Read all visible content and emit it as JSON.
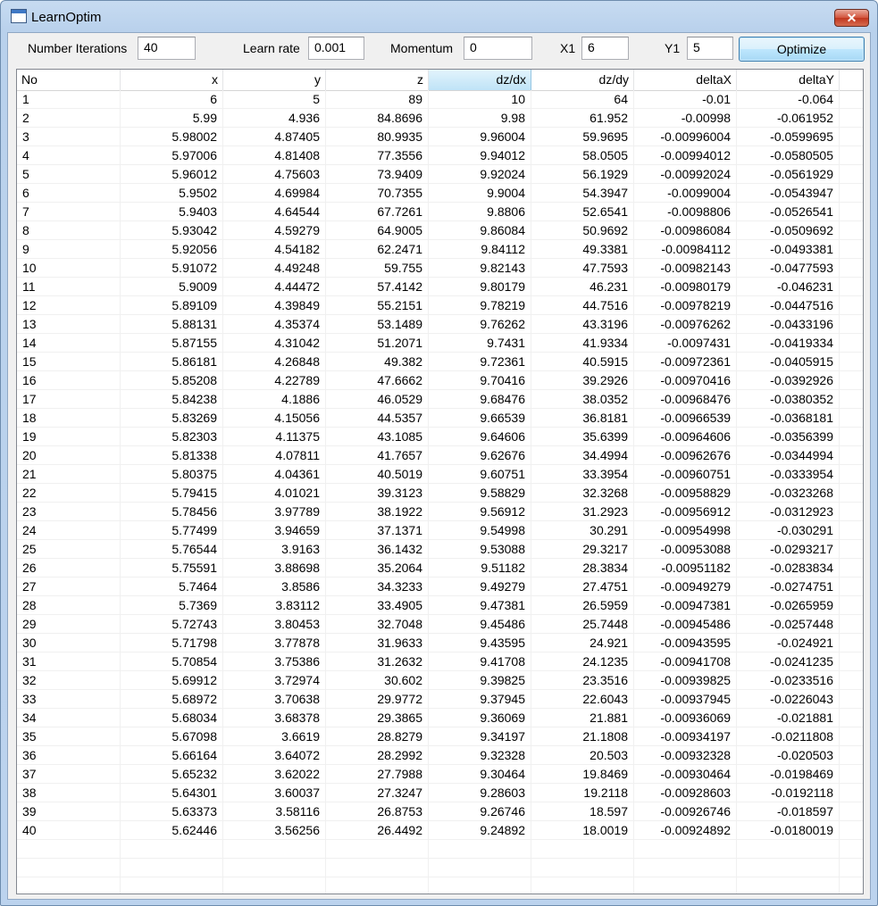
{
  "window": {
    "title": "LearnOptim",
    "close_label": "✕"
  },
  "toolbar": {
    "iterations_label": "Number Iterations",
    "iterations_value": "40",
    "learn_rate_label": "Learn rate",
    "learn_rate_value": "0.001",
    "momentum_label": "Momentum",
    "momentum_value": "0",
    "x1_label": "X1",
    "x1_value": "6",
    "y1_label": "Y1",
    "y1_value": "5",
    "optimize_label": "Optimize"
  },
  "table": {
    "selected_column": 4,
    "columns": [
      "No",
      "x",
      "y",
      "z",
      "dz/dx",
      "dz/dy",
      "deltaX",
      "deltaY"
    ],
    "rows": [
      [
        "1",
        "6",
        "5",
        "89",
        "10",
        "64",
        "-0.01",
        "-0.064"
      ],
      [
        "2",
        "5.99",
        "4.936",
        "84.8696",
        "9.98",
        "61.952",
        "-0.00998",
        "-0.061952"
      ],
      [
        "3",
        "5.98002",
        "4.87405",
        "80.9935",
        "9.96004",
        "59.9695",
        "-0.00996004",
        "-0.0599695"
      ],
      [
        "4",
        "5.97006",
        "4.81408",
        "77.3556",
        "9.94012",
        "58.0505",
        "-0.00994012",
        "-0.0580505"
      ],
      [
        "5",
        "5.96012",
        "4.75603",
        "73.9409",
        "9.92024",
        "56.1929",
        "-0.00992024",
        "-0.0561929"
      ],
      [
        "6",
        "5.9502",
        "4.69984",
        "70.7355",
        "9.9004",
        "54.3947",
        "-0.0099004",
        "-0.0543947"
      ],
      [
        "7",
        "5.9403",
        "4.64544",
        "67.7261",
        "9.8806",
        "52.6541",
        "-0.0098806",
        "-0.0526541"
      ],
      [
        "8",
        "5.93042",
        "4.59279",
        "64.9005",
        "9.86084",
        "50.9692",
        "-0.00986084",
        "-0.0509692"
      ],
      [
        "9",
        "5.92056",
        "4.54182",
        "62.2471",
        "9.84112",
        "49.3381",
        "-0.00984112",
        "-0.0493381"
      ],
      [
        "10",
        "5.91072",
        "4.49248",
        "59.755",
        "9.82143",
        "47.7593",
        "-0.00982143",
        "-0.0477593"
      ],
      [
        "11",
        "5.9009",
        "4.44472",
        "57.4142",
        "9.80179",
        "46.231",
        "-0.00980179",
        "-0.046231"
      ],
      [
        "12",
        "5.89109",
        "4.39849",
        "55.2151",
        "9.78219",
        "44.7516",
        "-0.00978219",
        "-0.0447516"
      ],
      [
        "13",
        "5.88131",
        "4.35374",
        "53.1489",
        "9.76262",
        "43.3196",
        "-0.00976262",
        "-0.0433196"
      ],
      [
        "14",
        "5.87155",
        "4.31042",
        "51.2071",
        "9.7431",
        "41.9334",
        "-0.0097431",
        "-0.0419334"
      ],
      [
        "15",
        "5.86181",
        "4.26848",
        "49.382",
        "9.72361",
        "40.5915",
        "-0.00972361",
        "-0.0405915"
      ],
      [
        "16",
        "5.85208",
        "4.22789",
        "47.6662",
        "9.70416",
        "39.2926",
        "-0.00970416",
        "-0.0392926"
      ],
      [
        "17",
        "5.84238",
        "4.1886",
        "46.0529",
        "9.68476",
        "38.0352",
        "-0.00968476",
        "-0.0380352"
      ],
      [
        "18",
        "5.83269",
        "4.15056",
        "44.5357",
        "9.66539",
        "36.8181",
        "-0.00966539",
        "-0.0368181"
      ],
      [
        "19",
        "5.82303",
        "4.11375",
        "43.1085",
        "9.64606",
        "35.6399",
        "-0.00964606",
        "-0.0356399"
      ],
      [
        "20",
        "5.81338",
        "4.07811",
        "41.7657",
        "9.62676",
        "34.4994",
        "-0.00962676",
        "-0.0344994"
      ],
      [
        "21",
        "5.80375",
        "4.04361",
        "40.5019",
        "9.60751",
        "33.3954",
        "-0.00960751",
        "-0.0333954"
      ],
      [
        "22",
        "5.79415",
        "4.01021",
        "39.3123",
        "9.58829",
        "32.3268",
        "-0.00958829",
        "-0.0323268"
      ],
      [
        "23",
        "5.78456",
        "3.97789",
        "38.1922",
        "9.56912",
        "31.2923",
        "-0.00956912",
        "-0.0312923"
      ],
      [
        "24",
        "5.77499",
        "3.94659",
        "37.1371",
        "9.54998",
        "30.291",
        "-0.00954998",
        "-0.030291"
      ],
      [
        "25",
        "5.76544",
        "3.9163",
        "36.1432",
        "9.53088",
        "29.3217",
        "-0.00953088",
        "-0.0293217"
      ],
      [
        "26",
        "5.75591",
        "3.88698",
        "35.2064",
        "9.51182",
        "28.3834",
        "-0.00951182",
        "-0.0283834"
      ],
      [
        "27",
        "5.7464",
        "3.8586",
        "34.3233",
        "9.49279",
        "27.4751",
        "-0.00949279",
        "-0.0274751"
      ],
      [
        "28",
        "5.7369",
        "3.83112",
        "33.4905",
        "9.47381",
        "26.5959",
        "-0.00947381",
        "-0.0265959"
      ],
      [
        "29",
        "5.72743",
        "3.80453",
        "32.7048",
        "9.45486",
        "25.7448",
        "-0.00945486",
        "-0.0257448"
      ],
      [
        "30",
        "5.71798",
        "3.77878",
        "31.9633",
        "9.43595",
        "24.921",
        "-0.00943595",
        "-0.024921"
      ],
      [
        "31",
        "5.70854",
        "3.75386",
        "31.2632",
        "9.41708",
        "24.1235",
        "-0.00941708",
        "-0.0241235"
      ],
      [
        "32",
        "5.69912",
        "3.72974",
        "30.602",
        "9.39825",
        "23.3516",
        "-0.00939825",
        "-0.0233516"
      ],
      [
        "33",
        "5.68972",
        "3.70638",
        "29.9772",
        "9.37945",
        "22.6043",
        "-0.00937945",
        "-0.0226043"
      ],
      [
        "34",
        "5.68034",
        "3.68378",
        "29.3865",
        "9.36069",
        "21.881",
        "-0.00936069",
        "-0.021881"
      ],
      [
        "35",
        "5.67098",
        "3.6619",
        "28.8279",
        "9.34197",
        "21.1808",
        "-0.00934197",
        "-0.0211808"
      ],
      [
        "36",
        "5.66164",
        "3.64072",
        "28.2992",
        "9.32328",
        "20.503",
        "-0.00932328",
        "-0.020503"
      ],
      [
        "37",
        "5.65232",
        "3.62022",
        "27.7988",
        "9.30464",
        "19.8469",
        "-0.00930464",
        "-0.0198469"
      ],
      [
        "38",
        "5.64301",
        "3.60037",
        "27.3247",
        "9.28603",
        "19.2118",
        "-0.00928603",
        "-0.0192118"
      ],
      [
        "39",
        "5.63373",
        "3.58116",
        "26.8753",
        "9.26746",
        "18.597",
        "-0.00926746",
        "-0.018597"
      ],
      [
        "40",
        "5.62446",
        "3.56256",
        "26.4492",
        "9.24892",
        "18.0019",
        "-0.00924892",
        "-0.0180019"
      ]
    ]
  }
}
